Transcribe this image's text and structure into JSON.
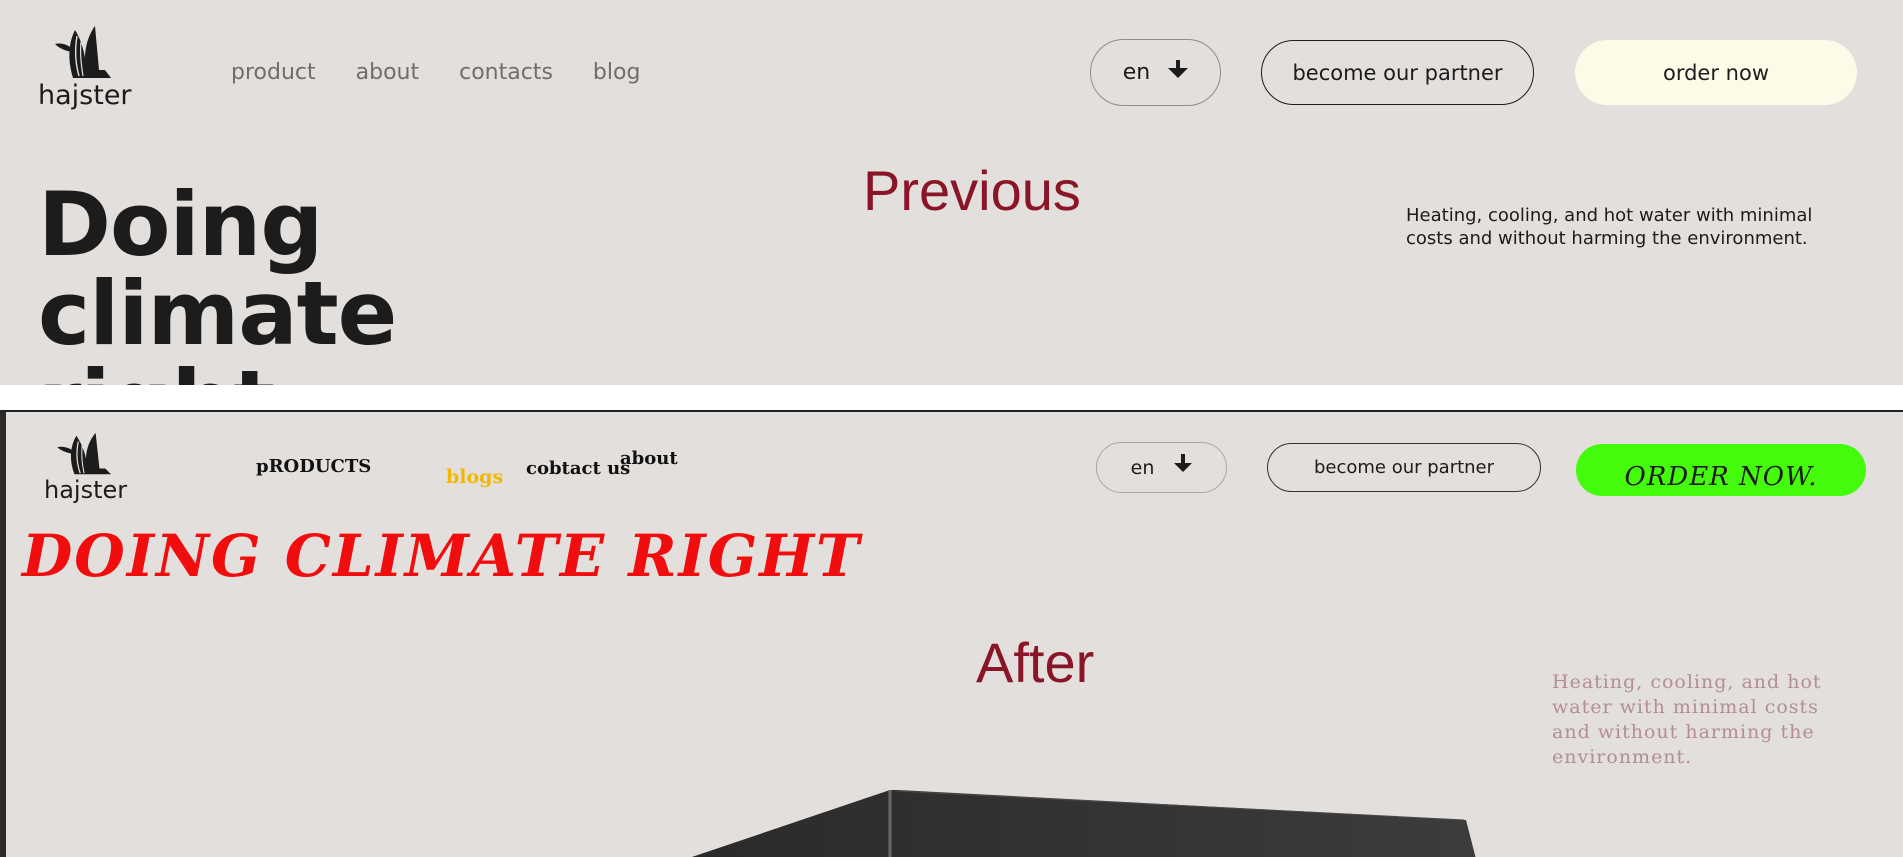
{
  "previous": {
    "label": "Previous",
    "logo_text": "hajster",
    "nav": [
      "product",
      "about",
      "contacts",
      "blog"
    ],
    "language": "en",
    "partner_button": "become our partner",
    "order_button": "order now",
    "hero_line1": "Doing climate",
    "hero_line2": "right",
    "subtitle": "Heating, cooling, and hot water with minimal costs and without harming the environment."
  },
  "after": {
    "label": "After",
    "logo_text": "hajster",
    "nav_products": "pRODUCTS",
    "nav_blogs": "blogs",
    "nav_contact": "cobtact us",
    "nav_about": "about",
    "language": "en",
    "partner_button": "become our partner",
    "order_button": "ORDER NOW.",
    "hero": "DOING CLIMATE RIGHT",
    "subtitle": "Heating, cooling, and hot water with minimal costs and without harming the environment."
  },
  "colors": {
    "panel_bg": "#e2dfdd",
    "label_color": "#8a1526",
    "order_prev_bg": "#fdfbe8",
    "order_after_bg": "#45fb0c",
    "hero_after_color": "#f10d0d",
    "blogs_after_color": "#f2b800"
  }
}
